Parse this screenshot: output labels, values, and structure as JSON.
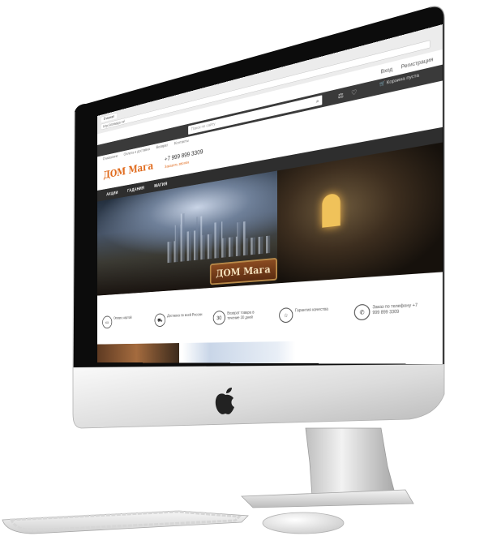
{
  "browser": {
    "tab_label": "Главная",
    "url": "http://domaga.ru/"
  },
  "site": {
    "auth": {
      "login": "Вход",
      "register": "Регистрация"
    },
    "search": {
      "placeholder": "Поиск по сайту"
    },
    "cart": {
      "label": "Корзина пуста"
    },
    "top_menu": [
      "О магазине",
      "Оплата и доставка",
      "Возврат",
      "Контакты"
    ],
    "logo_text": "ДОМ Мага",
    "phone": "+7 999 899 3309",
    "callback": "Заказать звонок",
    "categories": [
      "АКЦИИ",
      "ГАДАНИЯ",
      "МАГИЯ"
    ],
    "banner_sign": "ДОМ Мага",
    "features": [
      {
        "icon": "card",
        "text": "Оплата картой"
      },
      {
        "icon": "truck",
        "text": "Доставка по всей России"
      },
      {
        "icon": "30",
        "text": "Возврат товара в течение 30 дней"
      },
      {
        "icon": "star",
        "text": "Гарантия качества"
      },
      {
        "icon": "phone",
        "text": "Заказ по телефону +7 999 899 3309"
      }
    ]
  },
  "colors": {
    "brand_orange": "#e06a1c",
    "nav_dark": "#2e2e2e",
    "bar_dark": "#3a3a3a"
  }
}
